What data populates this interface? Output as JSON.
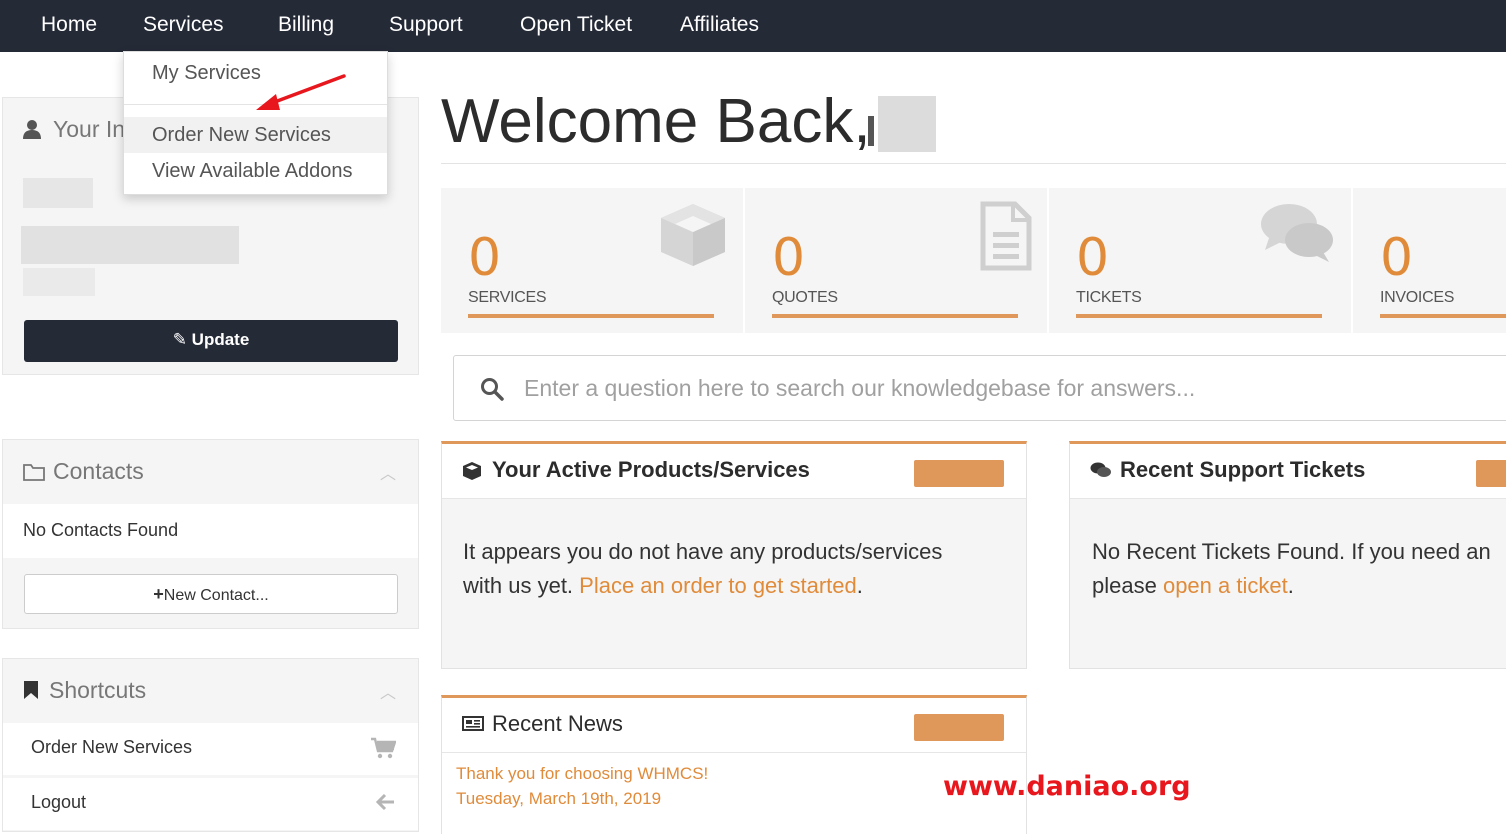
{
  "nav": {
    "items": [
      "Home",
      "Services",
      "Billing",
      "Support",
      "Open Ticket",
      "Affiliates"
    ]
  },
  "services_menu": {
    "items": [
      "My Services",
      "Order New Services",
      "View Available Addons"
    ],
    "active": "Order New Services"
  },
  "your_info_panel": {
    "title": "Your In",
    "update_button": "Update"
  },
  "contacts_panel": {
    "title": "Contacts",
    "empty_text": "No Contacts Found",
    "new_contact_button": "New Contact..."
  },
  "shortcuts_panel": {
    "title": "Shortcuts",
    "items": [
      {
        "label": "Order New Services",
        "icon": "cart-icon"
      },
      {
        "label": "Logout",
        "icon": "arrow-left-icon"
      }
    ]
  },
  "welcome": {
    "title": "Welcome Back, "
  },
  "stats": [
    {
      "value": "0",
      "label": "SERVICES",
      "icon": "cube-icon"
    },
    {
      "value": "0",
      "label": "QUOTES",
      "icon": "document-icon"
    },
    {
      "value": "0",
      "label": "TICKETS",
      "icon": "chat-bubbles-icon"
    },
    {
      "value": "0",
      "label": "INVOICES",
      "icon": "invoice-icon"
    }
  ],
  "search": {
    "placeholder": "Enter a question here to search our knowledgebase for answers..."
  },
  "active_products": {
    "title": "Your Active Products/Services",
    "body_line1": "It appears you do not have any products/services",
    "body_line2": "with us yet. ",
    "link": "Place an order to get started",
    "suffix": "."
  },
  "recent_tickets": {
    "title": "Recent Support Tickets",
    "body_line1": "No Recent Tickets Found. If you need an",
    "body_line2": "please ",
    "link": "open a ticket",
    "suffix": "."
  },
  "recent_news": {
    "title": "Recent News",
    "item_title": "Thank you for choosing WHMCS!",
    "item_date": "Tuesday, March 19th, 2019"
  },
  "watermark": "www.daniao.org",
  "colors": {
    "nav_bg": "#252a37",
    "accent": "#e0975a",
    "link": "#e08b3a",
    "panel_bg": "#f5f5f5"
  }
}
